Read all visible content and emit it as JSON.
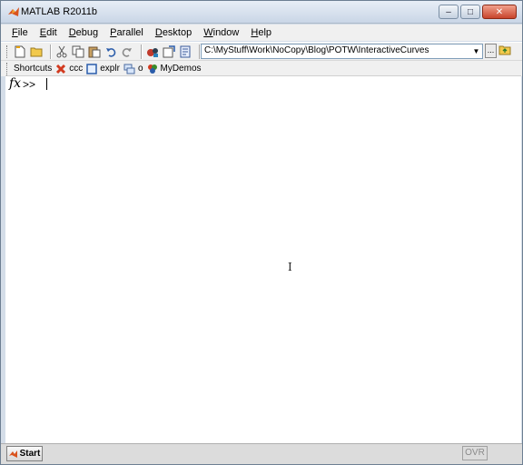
{
  "window": {
    "title": "MATLAB  R2011b"
  },
  "window_buttons": {
    "minimize": "–",
    "maximize": "□",
    "close": "✕"
  },
  "menu": {
    "items": [
      {
        "label": "File"
      },
      {
        "label": "Edit"
      },
      {
        "label": "Debug"
      },
      {
        "label": "Parallel"
      },
      {
        "label": "Desktop"
      },
      {
        "label": "Window"
      },
      {
        "label": "Help"
      }
    ]
  },
  "toolbar": {
    "icons": [
      "new-file-icon",
      "open-folder-icon",
      "cut-icon",
      "copy-icon",
      "paste-icon",
      "undo-icon",
      "redo-icon",
      "simulink-icon",
      "guide-icon",
      "profiler-icon",
      "help-icon"
    ],
    "current_folder": "C:\\MyStuff\\Work\\NoCopy\\Blog\\POTW\\InteractiveCurves",
    "browse_label": "..."
  },
  "shortcuts": {
    "label": "Shortcuts",
    "items": [
      {
        "label": "ccc",
        "icon": "red-x-icon"
      },
      {
        "label": "explr",
        "icon": "window-icon"
      },
      {
        "label": "o",
        "icon": "windows-icon"
      },
      {
        "label": "MyDemos",
        "icon": "shapes-icon"
      }
    ]
  },
  "command_window": {
    "fx": "fx",
    "prompt": ">>"
  },
  "statusbar": {
    "start_label": "Start",
    "ovr_label": "OVR"
  },
  "colors": {
    "accent": "#1f5fbf",
    "titlebar": "#c9d6e6"
  }
}
